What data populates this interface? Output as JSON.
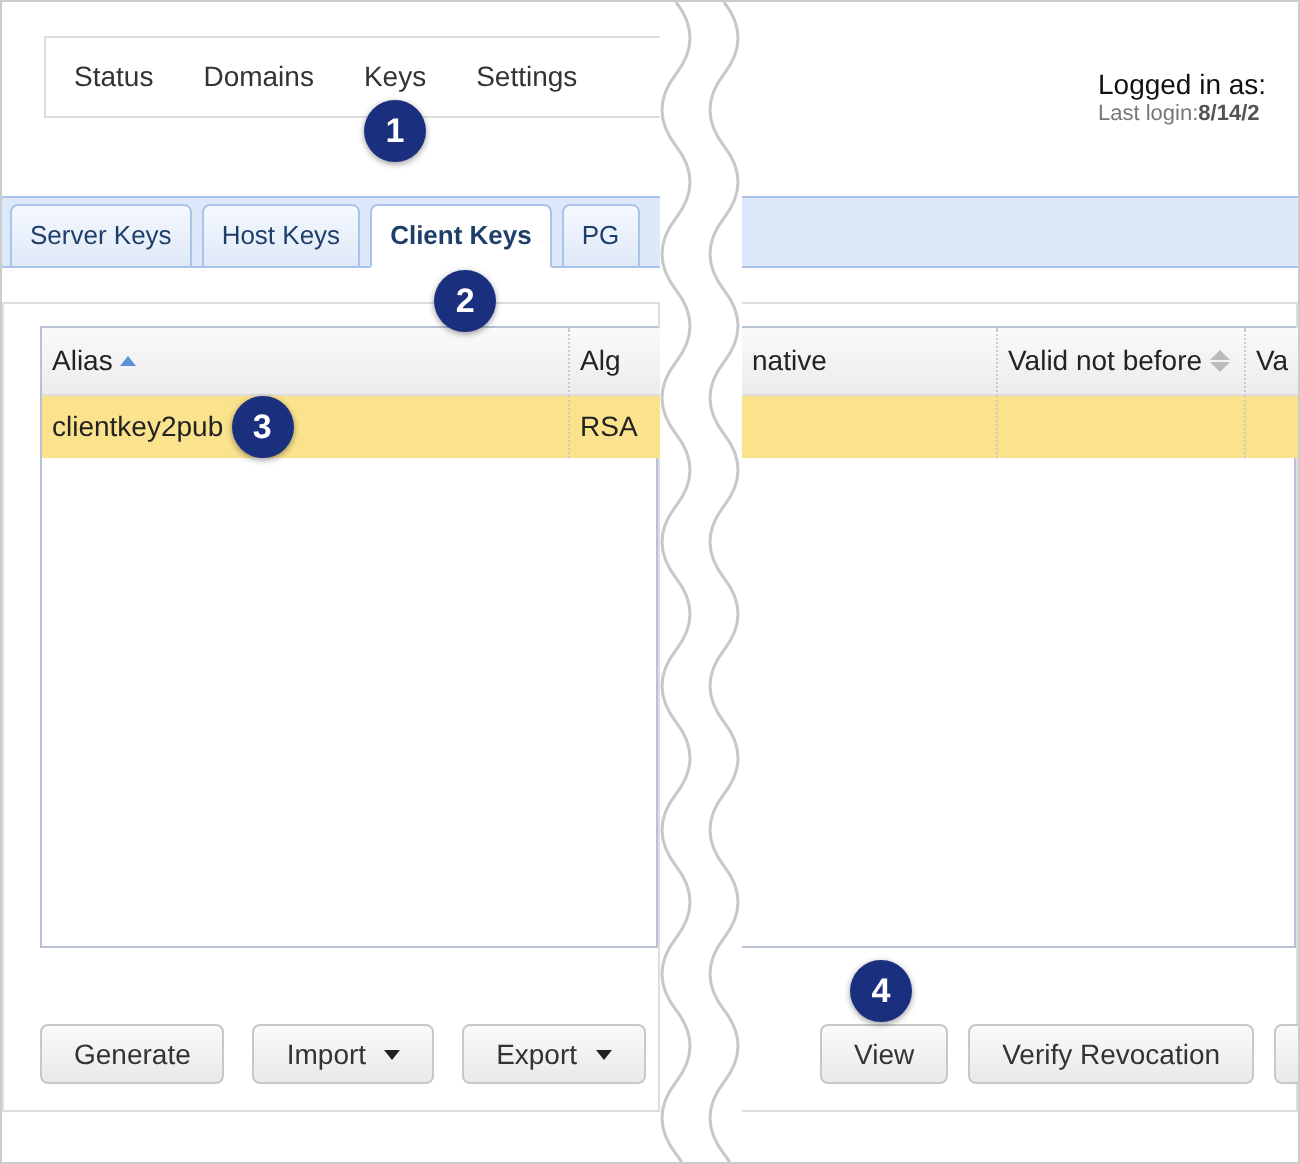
{
  "nav": [
    {
      "label": "Status"
    },
    {
      "label": "Domains"
    },
    {
      "label": "Keys",
      "callout": "1"
    },
    {
      "label": "Settings"
    }
  ],
  "user": {
    "logged_in": "Logged in as:",
    "last_login": "Last login:**8/14/2**"
  },
  "tabs": [
    {
      "label": "Server Keys",
      "selected": false
    },
    {
      "label": "Host Keys",
      "selected": false
    },
    {
      "label": "Client Keys",
      "selected": true,
      "callout": "2"
    },
    {
      "label": "PG",
      "selected": false
    }
  ],
  "table": {
    "columns_left": [
      {
        "label": "Alias",
        "sorted_ascending": true
      },
      {
        "label": "Alg",
        "sorted_ascending": false,
        "sortable": false
      }
    ],
    "columns_right": [
      {
        "label": "native",
        "sorted_ascending": false,
        "sortable": false
      },
      {
        "label": "Valid not before",
        "sorted_ascending": false,
        "sortable": true
      },
      {
        "label": "Va",
        "sorted_ascending": false,
        "sortable": false
      }
    ],
    "rows": [
      {
        "cells": [
          "clientkey2pub",
          "RSA"
        ],
        "selected": true,
        "callout": "3"
      }
    ]
  },
  "buttons_left": [
    {
      "label": "Generate",
      "dropdown": false
    },
    {
      "label": "Import",
      "dropdown": true
    },
    {
      "label": "Export",
      "dropdown": true
    }
  ],
  "buttons_right": [
    {
      "label": "View",
      "dropdown": false,
      "callout": "4"
    },
    {
      "label": "Verify Revocation",
      "dropdown": false
    },
    {
      "dropdown": false
    }
  ]
}
